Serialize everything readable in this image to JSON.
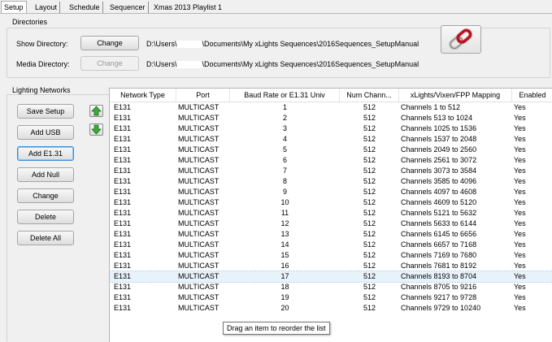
{
  "tabs": [
    "Setup",
    "Layout",
    "Schedule",
    "Sequencer",
    "Xmas 2013 Playlist 1"
  ],
  "directories": {
    "section_label": "Directories",
    "show_label": "Show Directory:",
    "show_button": "Change",
    "show_path_prefix": "D:\\Users\\",
    "show_path_suffix": "\\Documents\\My xLights Sequences\\2016Sequences_SetupManual",
    "media_label": "Media Directory:",
    "media_button": "Change",
    "media_path_prefix": "D:\\Users\\",
    "media_path_suffix": "\\Documents\\My xLights Sequences\\2016Sequences_SetupManual"
  },
  "networks": {
    "section_label": "Lighting Networks",
    "buttons": [
      "Save Setup",
      "Add USB",
      "Add E1.31",
      "Add Null",
      "Change",
      "Delete",
      "Delete All"
    ],
    "columns": [
      "Network Type",
      "Port",
      "Baud Rate or E1.31 Univ",
      "Num Chann...",
      "xLights/Vixen/FPP Mapping",
      "Enabled"
    ],
    "rows": [
      [
        "E131",
        "MULTICAST",
        "1",
        "512",
        "Channels 1 to 512",
        "Yes"
      ],
      [
        "E131",
        "MULTICAST",
        "2",
        "512",
        "Channels 513 to 1024",
        "Yes"
      ],
      [
        "E131",
        "MULTICAST",
        "3",
        "512",
        "Channels 1025 to 1536",
        "Yes"
      ],
      [
        "E131",
        "MULTICAST",
        "4",
        "512",
        "Channels 1537 to 2048",
        "Yes"
      ],
      [
        "E131",
        "MULTICAST",
        "5",
        "512",
        "Channels 2049 to 2560",
        "Yes"
      ],
      [
        "E131",
        "MULTICAST",
        "6",
        "512",
        "Channels 2561 to 3072",
        "Yes"
      ],
      [
        "E131",
        "MULTICAST",
        "7",
        "512",
        "Channels 3073 to 3584",
        "Yes"
      ],
      [
        "E131",
        "MULTICAST",
        "8",
        "512",
        "Channels 3585 to 4096",
        "Yes"
      ],
      [
        "E131",
        "MULTICAST",
        "9",
        "512",
        "Channels 4097 to 4608",
        "Yes"
      ],
      [
        "E131",
        "MULTICAST",
        "10",
        "512",
        "Channels 4609 to 5120",
        "Yes"
      ],
      [
        "E131",
        "MULTICAST",
        "11",
        "512",
        "Channels 5121 to 5632",
        "Yes"
      ],
      [
        "E131",
        "MULTICAST",
        "12",
        "512",
        "Channels 5633 to 6144",
        "Yes"
      ],
      [
        "E131",
        "MULTICAST",
        "13",
        "512",
        "Channels 6145 to 6656",
        "Yes"
      ],
      [
        "E131",
        "MULTICAST",
        "14",
        "512",
        "Channels 6657 to 7168",
        "Yes"
      ],
      [
        "E131",
        "MULTICAST",
        "15",
        "512",
        "Channels 7169 to 7680",
        "Yes"
      ],
      [
        "E131",
        "MULTICAST",
        "16",
        "512",
        "Channels 7681 to 8192",
        "Yes"
      ],
      [
        "E131",
        "MULTICAST",
        "17",
        "512",
        "Channels 8193 to 8704",
        "Yes"
      ],
      [
        "E131",
        "MULTICAST",
        "18",
        "512",
        "Channels 8705 to 9216",
        "Yes"
      ],
      [
        "E131",
        "MULTICAST",
        "19",
        "512",
        "Channels 9217 to 9728",
        "Yes"
      ],
      [
        "E131",
        "MULTICAST",
        "20",
        "512",
        "Channels 9729 to 10240",
        "Yes"
      ]
    ],
    "selected_row": 16,
    "tooltip": "Drag an item to reorder the list"
  },
  "icons": {
    "link": "chain-link-icon",
    "up": "green-up-arrow-icon",
    "down": "green-down-arrow-icon"
  },
  "colors": {
    "arrow_green": "#3fa83a",
    "link_red": "#d0202a",
    "selection": "#e8f2fb"
  }
}
